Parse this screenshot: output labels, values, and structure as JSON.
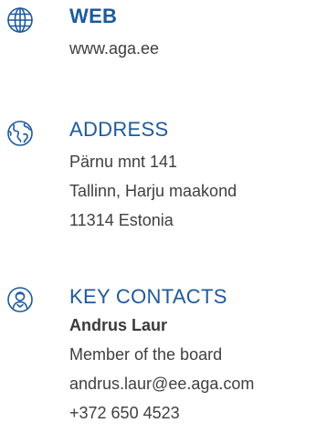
{
  "web": {
    "icon": "globe-grid-icon",
    "heading": "WEB",
    "lines": [
      "www.aga.ee"
    ]
  },
  "address": {
    "icon": "earth-icon",
    "heading": "ADDRESS",
    "lines": [
      "Pärnu mnt 141",
      "Tallinn, Harju maakond",
      "11314 Estonia"
    ]
  },
  "key_contacts": {
    "icon": "person-icon",
    "heading": "KEY CONTACTS",
    "name": "Andrus Laur",
    "lines": [
      "Member of the board",
      "andrus.laur@ee.aga.com",
      "+372 650 4523"
    ]
  },
  "colors": {
    "accent": "#1d5a9e",
    "text": "#3f3f3f"
  }
}
